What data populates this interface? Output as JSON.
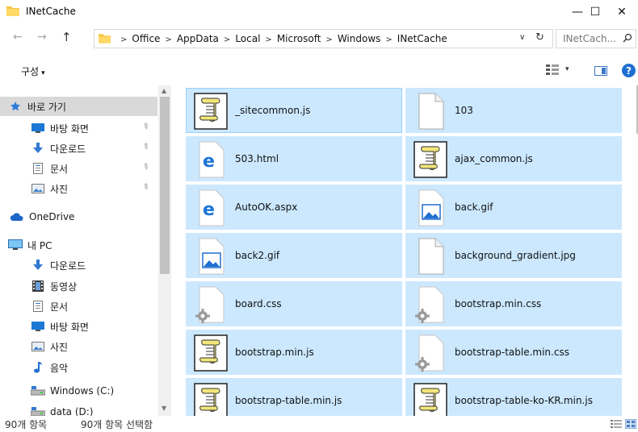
{
  "window": {
    "title": "INetCache",
    "minimize": "—",
    "maximize": "☐",
    "close": "✕"
  },
  "nav": {
    "back": "←",
    "forward": "→",
    "up": "↑",
    "breadcrumbs": [
      "Office",
      "AppData",
      "Local",
      "Microsoft",
      "Windows",
      "INetCache"
    ],
    "dropdown": "∨",
    "refresh": "↻",
    "search_placeholder": "INetCach...",
    "search_icon": "⚲"
  },
  "command": {
    "organize": "구성",
    "caret": "▾"
  },
  "sidebar": {
    "items": [
      {
        "label": "바로 가기",
        "icon": "star-icon",
        "pinned": false,
        "selected": true
      },
      {
        "label": "바탕 화면",
        "icon": "desktop-icon",
        "pinned": true
      },
      {
        "label": "다운로드",
        "icon": "download-icon",
        "pinned": true
      },
      {
        "label": "문서",
        "icon": "document-icon",
        "pinned": true
      },
      {
        "label": "사진",
        "icon": "pictures-icon",
        "pinned": true
      },
      {
        "label": "OneDrive",
        "icon": "cloud-icon",
        "pinned": false
      },
      {
        "label": "내 PC",
        "icon": "computer-icon",
        "pinned": false
      },
      {
        "label": "다운로드",
        "icon": "download-icon",
        "pinned": false
      },
      {
        "label": "동영상",
        "icon": "video-icon",
        "pinned": false
      },
      {
        "label": "문서",
        "icon": "document-icon",
        "pinned": false
      },
      {
        "label": "바탕 화면",
        "icon": "desktop-icon",
        "pinned": false
      },
      {
        "label": "사진",
        "icon": "pictures-icon",
        "pinned": false
      },
      {
        "label": "음악",
        "icon": "music-icon",
        "pinned": false
      },
      {
        "label": "Windows (C:)",
        "icon": "drive-icon",
        "pinned": false
      },
      {
        "label": "data (D:)",
        "icon": "drive-icon",
        "pinned": false
      }
    ]
  },
  "files": [
    {
      "name": "_sitecommon.js",
      "icon": "script-icon"
    },
    {
      "name": "103",
      "icon": "blank-file-icon"
    },
    {
      "name": "503.html",
      "icon": "edge-icon"
    },
    {
      "name": "ajax_common.js",
      "icon": "script-icon"
    },
    {
      "name": "AutoOK.aspx",
      "icon": "edge-icon"
    },
    {
      "name": "back.gif",
      "icon": "image-icon"
    },
    {
      "name": "back2.gif",
      "icon": "image-icon"
    },
    {
      "name": "background_gradient.jpg",
      "icon": "blank-file-icon"
    },
    {
      "name": "board.css",
      "icon": "css-gear-icon"
    },
    {
      "name": "bootstrap.min.css",
      "icon": "css-gear-icon"
    },
    {
      "name": "bootstrap.min.js",
      "icon": "script-icon"
    },
    {
      "name": "bootstrap-table.min.css",
      "icon": "css-gear-icon"
    },
    {
      "name": "bootstrap-table.min.js",
      "icon": "script-icon"
    },
    {
      "name": "bootstrap-table-ko-KR.min.js",
      "icon": "script-icon"
    }
  ],
  "status": {
    "count": "90개 항목",
    "selected": "90개 항목 선택함"
  },
  "colors": {
    "selection": "#cce8ff",
    "selection_border": "#99d1ff",
    "accent": "#1f6fd1",
    "folder": "#f5c542"
  }
}
